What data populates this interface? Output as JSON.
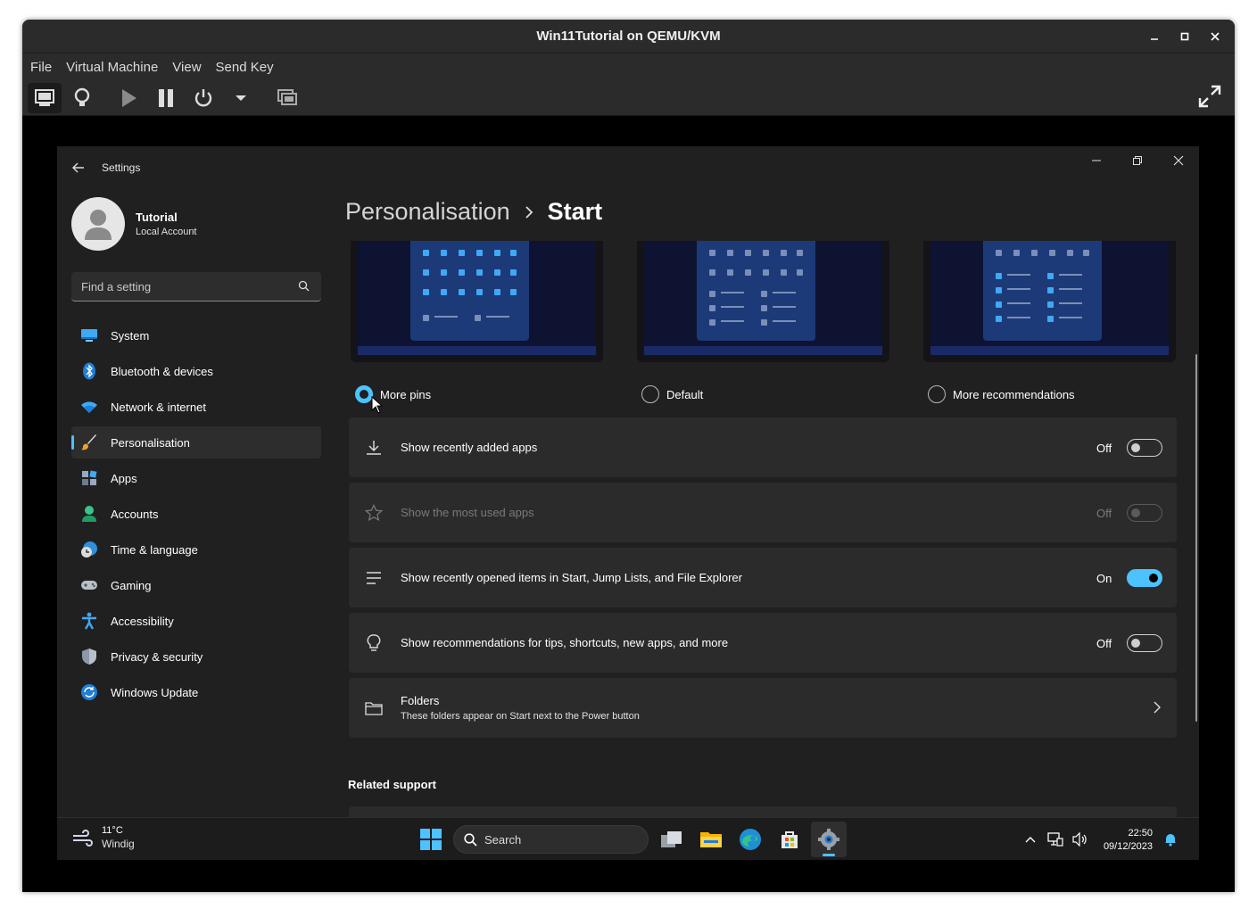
{
  "vm": {
    "title": "Win11Tutorial on QEMU/KVM",
    "menu": [
      "File",
      "Virtual Machine",
      "View",
      "Send Key"
    ]
  },
  "settings": {
    "app_title": "Settings",
    "profile": {
      "name": "Tutorial",
      "account_type": "Local Account"
    },
    "search_placeholder": "Find a setting",
    "nav": [
      {
        "label": "System",
        "icon": "system-icon"
      },
      {
        "label": "Bluetooth & devices",
        "icon": "bluetooth-icon"
      },
      {
        "label": "Network & internet",
        "icon": "wifi-icon"
      },
      {
        "label": "Personalisation",
        "icon": "brush-icon",
        "selected": true
      },
      {
        "label": "Apps",
        "icon": "apps-icon"
      },
      {
        "label": "Accounts",
        "icon": "accounts-icon"
      },
      {
        "label": "Time & language",
        "icon": "time-language-icon"
      },
      {
        "label": "Gaming",
        "icon": "gamepad-icon"
      },
      {
        "label": "Accessibility",
        "icon": "accessibility-icon"
      },
      {
        "label": "Privacy & security",
        "icon": "shield-icon"
      },
      {
        "label": "Windows Update",
        "icon": "update-icon"
      }
    ],
    "breadcrumb": {
      "parent": "Personalisation",
      "current": "Start"
    },
    "layouts": [
      {
        "label": "More pins",
        "checked": true
      },
      {
        "label": "Default",
        "checked": false
      },
      {
        "label": "More recommendations",
        "checked": false
      }
    ],
    "toggles": [
      {
        "label": "Show recently added apps",
        "state": "Off",
        "on": false,
        "disabled": false,
        "icon": "download-icon"
      },
      {
        "label": "Show the most used apps",
        "state": "Off",
        "on": false,
        "disabled": true,
        "icon": "star-icon"
      },
      {
        "label": "Show recently opened items in Start, Jump Lists, and File Explorer",
        "state": "On",
        "on": true,
        "disabled": false,
        "icon": "list-icon"
      },
      {
        "label": "Show recommendations for tips, shortcuts, new apps, and more",
        "state": "Off",
        "on": false,
        "disabled": false,
        "icon": "lightbulb-icon"
      }
    ],
    "folders": {
      "title": "Folders",
      "subtitle": "These folders appear on Start next to the Power button"
    },
    "related_support": "Related support"
  },
  "taskbar": {
    "weather": {
      "temp": "11°C",
      "desc": "Windig"
    },
    "search_label": "Search",
    "time": "22:50",
    "date": "09/12/2023"
  },
  "colors": {
    "accent": "#4cc2ff",
    "background": "#202020",
    "card": "#2b2b2b"
  }
}
